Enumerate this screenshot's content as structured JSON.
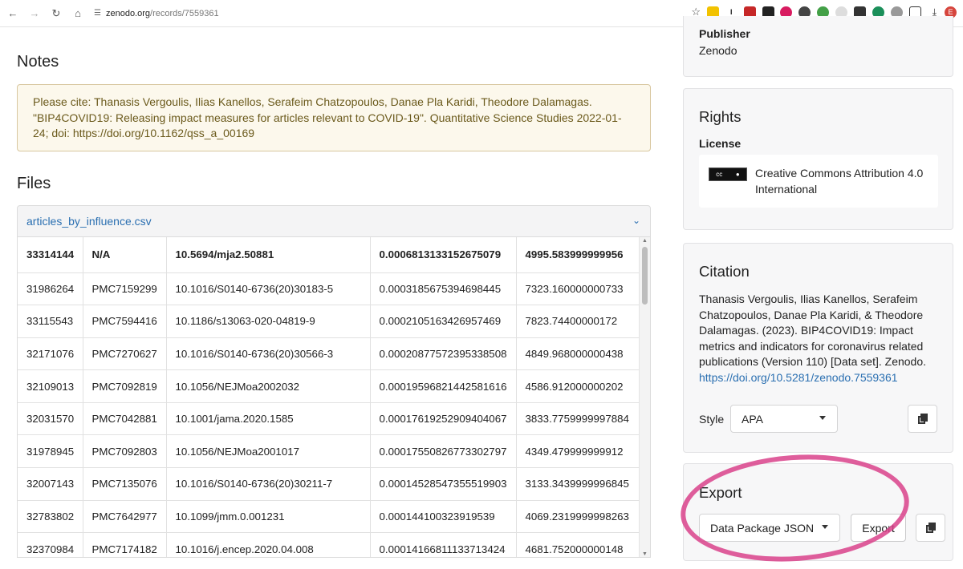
{
  "browser": {
    "url_domain": "zenodo.org",
    "url_path": "/records/7559361",
    "avatar_letter": "E"
  },
  "notes": {
    "title": "Notes",
    "text": "Please cite: Thanasis Vergoulis, Ilias Kanellos, Serafeim Chatzopoulos, Danae Pla Karidi, Theodore Dalamagas. \"BIP4COVID19: Releasing impact measures for articles relevant to COVID-19\". Quantitative Science Studies 2022-01-24; doi: https://doi.org/10.1162/qss_a_00169"
  },
  "files": {
    "title": "Files",
    "filename": "articles_by_influence.csv",
    "rows": [
      [
        "33314144",
        "N/A",
        "10.5694/mja2.50881",
        "0.0006813133152675079",
        "4995.583999999956"
      ],
      [
        "31986264",
        "PMC7159299",
        "10.1016/S0140-6736(20)30183-5",
        "0.0003185675394698445",
        "7323.160000000733"
      ],
      [
        "33115543",
        "PMC7594416",
        "10.1186/s13063-020-04819-9",
        "0.0002105163426957469",
        "7823.74400000172"
      ],
      [
        "32171076",
        "PMC7270627",
        "10.1016/S0140-6736(20)30566-3",
        "0.00020877572395338508",
        "4849.968000000438"
      ],
      [
        "32109013",
        "PMC7092819",
        "10.1056/NEJMoa2002032",
        "0.00019596821442581616",
        "4586.912000000202"
      ],
      [
        "32031570",
        "PMC7042881",
        "10.1001/jama.2020.1585",
        "0.00017619252909404067",
        "3833.7759999997884"
      ],
      [
        "31978945",
        "PMC7092803",
        "10.1056/NEJMoa2001017",
        "0.00017550826773302797",
        "4349.479999999912"
      ],
      [
        "32007143",
        "PMC7135076",
        "10.1016/S0140-6736(20)30211-7",
        "0.00014528547355519903",
        "3133.3439999996845"
      ],
      [
        "32783802",
        "PMC7642977",
        "10.1099/jmm.0.001231",
        "0.000144100323919539",
        "4069.2319999998263"
      ],
      [
        "32370984",
        "PMC7174182",
        "10.1016/j.encep.2020.04.008",
        "0.00014166811133713424",
        "4681.752000000148"
      ]
    ]
  },
  "publisher": {
    "label": "Publisher",
    "value": "Zenodo"
  },
  "rights": {
    "title": "Rights",
    "license_label": "License",
    "license_line1": "Creative Commons Attribution 4.0",
    "license_line2": "International"
  },
  "citation": {
    "title": "Citation",
    "text": "Thanasis Vergoulis, Ilias Kanellos, Serafeim Chatzopoulos, Danae Pla Karidi, & Theodore Dalamagas. (2023). BIP4COVID19: Impact metrics and indicators for coronavirus related publications (Version 110) [Data set]. Zenodo.",
    "doi": "https://doi.org/10.5281/zenodo.7559361",
    "style_label": "Style",
    "style_value": "APA"
  },
  "export": {
    "title": "Export",
    "format_value": "Data Package JSON",
    "button_label": "Export"
  },
  "colors": {
    "link": "#2a6fb1",
    "note_bg": "#fcf8ec",
    "highlight_circle": "#d9428b"
  },
  "icons": [
    "back-icon",
    "forward-icon",
    "reload-icon",
    "home-icon",
    "site-settings-icon",
    "bookmark-star-icon",
    "download-icon",
    "copy-icon",
    "chevron-down-icon",
    "cc-by-license-icon"
  ]
}
